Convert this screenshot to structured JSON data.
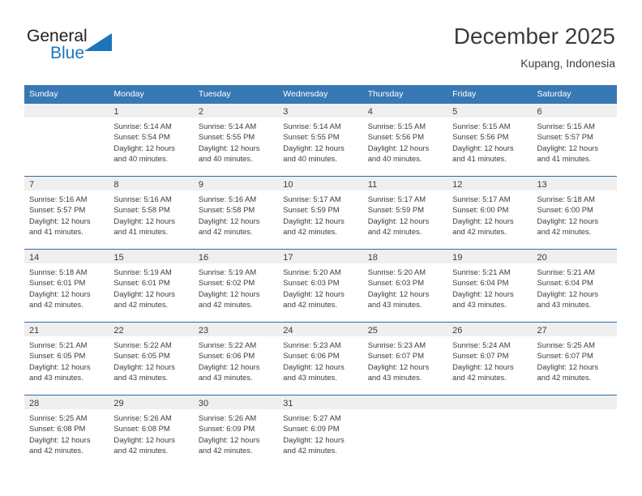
{
  "brand": {
    "name_top": "General",
    "name_bottom": "Blue",
    "accent_color": "#1b75bb",
    "triangle_icon": "triangle-logo-icon"
  },
  "header": {
    "month_title": "December 2025",
    "location": "Kupang, Indonesia"
  },
  "calendar": {
    "header_bg": "#3878b4",
    "row_border_color": "#2b6caa",
    "daynum_band_bg": "#efefef",
    "weekdays": [
      "Sunday",
      "Monday",
      "Tuesday",
      "Wednesday",
      "Thursday",
      "Friday",
      "Saturday"
    ],
    "weeks": [
      [
        {
          "day": "",
          "sunrise": "",
          "sunset": "",
          "daylight1": "",
          "daylight2": ""
        },
        {
          "day": "1",
          "sunrise": "Sunrise: 5:14 AM",
          "sunset": "Sunset: 5:54 PM",
          "daylight1": "Daylight: 12 hours",
          "daylight2": "and 40 minutes."
        },
        {
          "day": "2",
          "sunrise": "Sunrise: 5:14 AM",
          "sunset": "Sunset: 5:55 PM",
          "daylight1": "Daylight: 12 hours",
          "daylight2": "and 40 minutes."
        },
        {
          "day": "3",
          "sunrise": "Sunrise: 5:14 AM",
          "sunset": "Sunset: 5:55 PM",
          "daylight1": "Daylight: 12 hours",
          "daylight2": "and 40 minutes."
        },
        {
          "day": "4",
          "sunrise": "Sunrise: 5:15 AM",
          "sunset": "Sunset: 5:56 PM",
          "daylight1": "Daylight: 12 hours",
          "daylight2": "and 40 minutes."
        },
        {
          "day": "5",
          "sunrise": "Sunrise: 5:15 AM",
          "sunset": "Sunset: 5:56 PM",
          "daylight1": "Daylight: 12 hours",
          "daylight2": "and 41 minutes."
        },
        {
          "day": "6",
          "sunrise": "Sunrise: 5:15 AM",
          "sunset": "Sunset: 5:57 PM",
          "daylight1": "Daylight: 12 hours",
          "daylight2": "and 41 minutes."
        }
      ],
      [
        {
          "day": "7",
          "sunrise": "Sunrise: 5:16 AM",
          "sunset": "Sunset: 5:57 PM",
          "daylight1": "Daylight: 12 hours",
          "daylight2": "and 41 minutes."
        },
        {
          "day": "8",
          "sunrise": "Sunrise: 5:16 AM",
          "sunset": "Sunset: 5:58 PM",
          "daylight1": "Daylight: 12 hours",
          "daylight2": "and 41 minutes."
        },
        {
          "day": "9",
          "sunrise": "Sunrise: 5:16 AM",
          "sunset": "Sunset: 5:58 PM",
          "daylight1": "Daylight: 12 hours",
          "daylight2": "and 42 minutes."
        },
        {
          "day": "10",
          "sunrise": "Sunrise: 5:17 AM",
          "sunset": "Sunset: 5:59 PM",
          "daylight1": "Daylight: 12 hours",
          "daylight2": "and 42 minutes."
        },
        {
          "day": "11",
          "sunrise": "Sunrise: 5:17 AM",
          "sunset": "Sunset: 5:59 PM",
          "daylight1": "Daylight: 12 hours",
          "daylight2": "and 42 minutes."
        },
        {
          "day": "12",
          "sunrise": "Sunrise: 5:17 AM",
          "sunset": "Sunset: 6:00 PM",
          "daylight1": "Daylight: 12 hours",
          "daylight2": "and 42 minutes."
        },
        {
          "day": "13",
          "sunrise": "Sunrise: 5:18 AM",
          "sunset": "Sunset: 6:00 PM",
          "daylight1": "Daylight: 12 hours",
          "daylight2": "and 42 minutes."
        }
      ],
      [
        {
          "day": "14",
          "sunrise": "Sunrise: 5:18 AM",
          "sunset": "Sunset: 6:01 PM",
          "daylight1": "Daylight: 12 hours",
          "daylight2": "and 42 minutes."
        },
        {
          "day": "15",
          "sunrise": "Sunrise: 5:19 AM",
          "sunset": "Sunset: 6:01 PM",
          "daylight1": "Daylight: 12 hours",
          "daylight2": "and 42 minutes."
        },
        {
          "day": "16",
          "sunrise": "Sunrise: 5:19 AM",
          "sunset": "Sunset: 6:02 PM",
          "daylight1": "Daylight: 12 hours",
          "daylight2": "and 42 minutes."
        },
        {
          "day": "17",
          "sunrise": "Sunrise: 5:20 AM",
          "sunset": "Sunset: 6:03 PM",
          "daylight1": "Daylight: 12 hours",
          "daylight2": "and 42 minutes."
        },
        {
          "day": "18",
          "sunrise": "Sunrise: 5:20 AM",
          "sunset": "Sunset: 6:03 PM",
          "daylight1": "Daylight: 12 hours",
          "daylight2": "and 43 minutes."
        },
        {
          "day": "19",
          "sunrise": "Sunrise: 5:21 AM",
          "sunset": "Sunset: 6:04 PM",
          "daylight1": "Daylight: 12 hours",
          "daylight2": "and 43 minutes."
        },
        {
          "day": "20",
          "sunrise": "Sunrise: 5:21 AM",
          "sunset": "Sunset: 6:04 PM",
          "daylight1": "Daylight: 12 hours",
          "daylight2": "and 43 minutes."
        }
      ],
      [
        {
          "day": "21",
          "sunrise": "Sunrise: 5:21 AM",
          "sunset": "Sunset: 6:05 PM",
          "daylight1": "Daylight: 12 hours",
          "daylight2": "and 43 minutes."
        },
        {
          "day": "22",
          "sunrise": "Sunrise: 5:22 AM",
          "sunset": "Sunset: 6:05 PM",
          "daylight1": "Daylight: 12 hours",
          "daylight2": "and 43 minutes."
        },
        {
          "day": "23",
          "sunrise": "Sunrise: 5:22 AM",
          "sunset": "Sunset: 6:06 PM",
          "daylight1": "Daylight: 12 hours",
          "daylight2": "and 43 minutes."
        },
        {
          "day": "24",
          "sunrise": "Sunrise: 5:23 AM",
          "sunset": "Sunset: 6:06 PM",
          "daylight1": "Daylight: 12 hours",
          "daylight2": "and 43 minutes."
        },
        {
          "day": "25",
          "sunrise": "Sunrise: 5:23 AM",
          "sunset": "Sunset: 6:07 PM",
          "daylight1": "Daylight: 12 hours",
          "daylight2": "and 43 minutes."
        },
        {
          "day": "26",
          "sunrise": "Sunrise: 5:24 AM",
          "sunset": "Sunset: 6:07 PM",
          "daylight1": "Daylight: 12 hours",
          "daylight2": "and 42 minutes."
        },
        {
          "day": "27",
          "sunrise": "Sunrise: 5:25 AM",
          "sunset": "Sunset: 6:07 PM",
          "daylight1": "Daylight: 12 hours",
          "daylight2": "and 42 minutes."
        }
      ],
      [
        {
          "day": "28",
          "sunrise": "Sunrise: 5:25 AM",
          "sunset": "Sunset: 6:08 PM",
          "daylight1": "Daylight: 12 hours",
          "daylight2": "and 42 minutes."
        },
        {
          "day": "29",
          "sunrise": "Sunrise: 5:26 AM",
          "sunset": "Sunset: 6:08 PM",
          "daylight1": "Daylight: 12 hours",
          "daylight2": "and 42 minutes."
        },
        {
          "day": "30",
          "sunrise": "Sunrise: 5:26 AM",
          "sunset": "Sunset: 6:09 PM",
          "daylight1": "Daylight: 12 hours",
          "daylight2": "and 42 minutes."
        },
        {
          "day": "31",
          "sunrise": "Sunrise: 5:27 AM",
          "sunset": "Sunset: 6:09 PM",
          "daylight1": "Daylight: 12 hours",
          "daylight2": "and 42 minutes."
        },
        {
          "day": "",
          "sunrise": "",
          "sunset": "",
          "daylight1": "",
          "daylight2": ""
        },
        {
          "day": "",
          "sunrise": "",
          "sunset": "",
          "daylight1": "",
          "daylight2": ""
        },
        {
          "day": "",
          "sunrise": "",
          "sunset": "",
          "daylight1": "",
          "daylight2": ""
        }
      ]
    ]
  }
}
